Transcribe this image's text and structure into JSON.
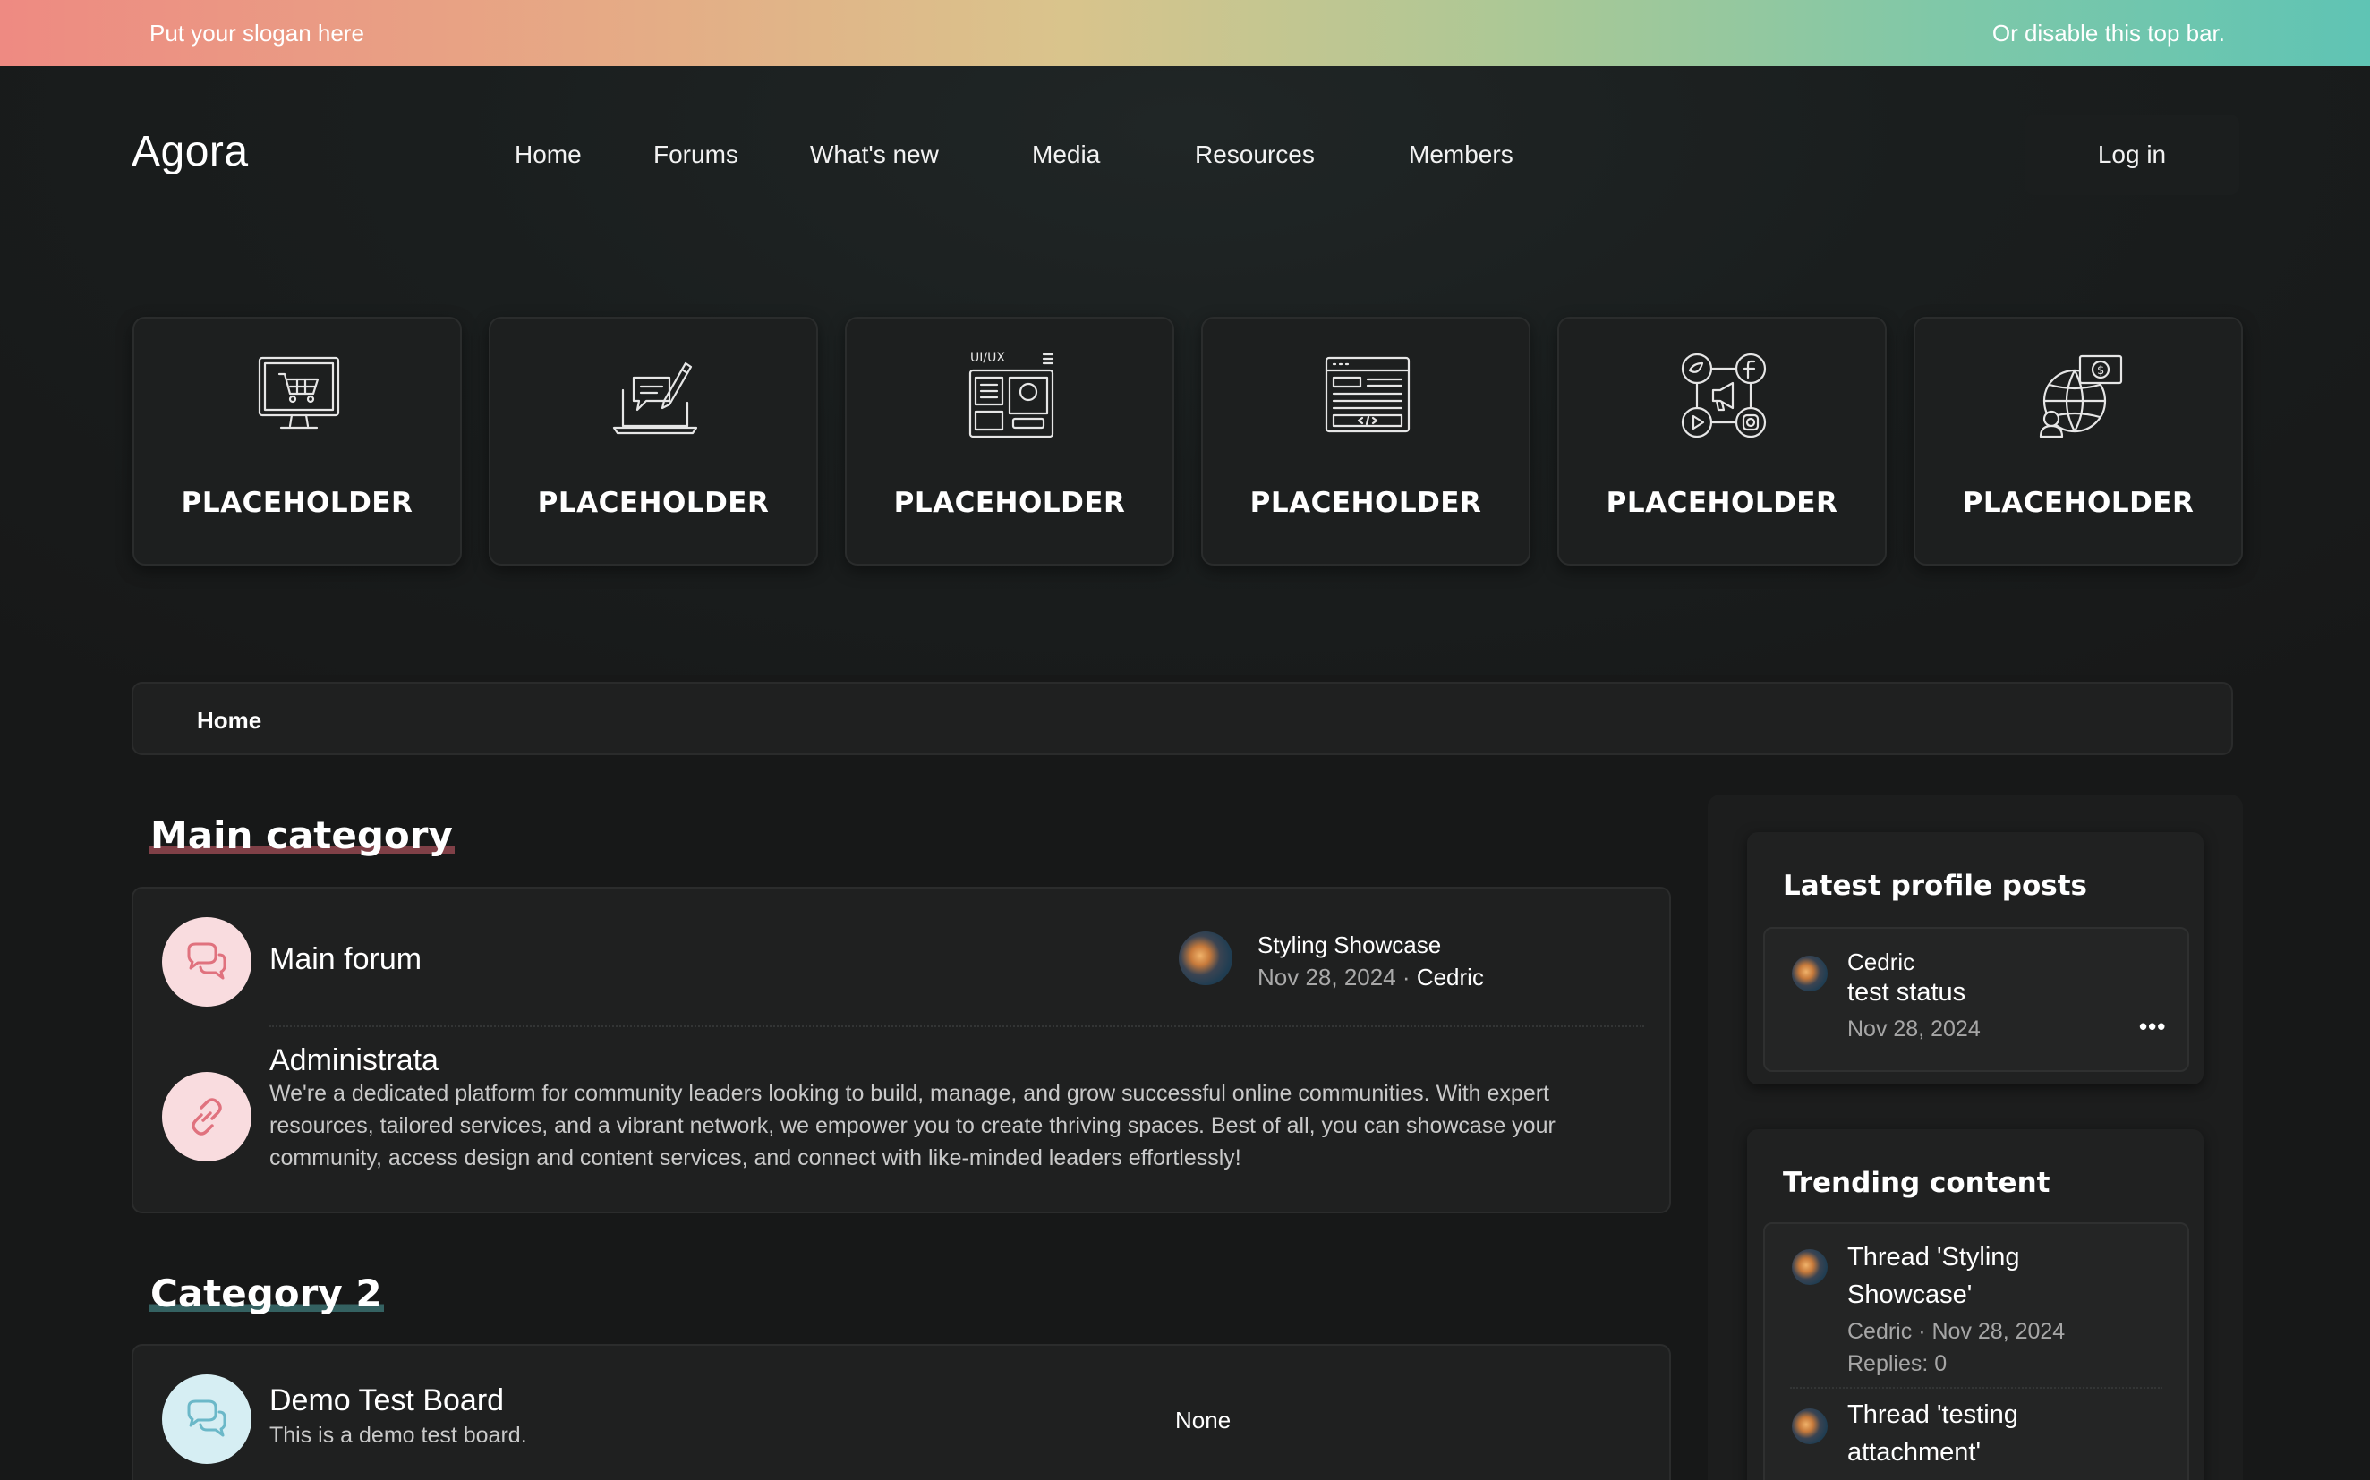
{
  "topbar": {
    "slogan": "Put your slogan here",
    "right_text": "Or disable this top bar."
  },
  "header": {
    "logo": "Agora",
    "nav": [
      {
        "label": "Home"
      },
      {
        "label": "Forums"
      },
      {
        "label": "What's new"
      },
      {
        "label": "Media"
      },
      {
        "label": "Resources"
      },
      {
        "label": "Members"
      }
    ],
    "login_label": "Log in"
  },
  "feature_cards": [
    {
      "label": "PLACEHOLDER",
      "icon": "shopping-cart-monitor-icon"
    },
    {
      "label": "PLACEHOLDER",
      "icon": "laptop-chat-pen-icon"
    },
    {
      "label": "PLACEHOLDER",
      "icon": "ui-ux-layout-icon",
      "icon_text": "UI/UX"
    },
    {
      "label": "PLACEHOLDER",
      "icon": "code-window-icon"
    },
    {
      "label": "PLACEHOLDER",
      "icon": "social-media-network-icon"
    },
    {
      "label": "PLACEHOLDER",
      "icon": "globe-money-icon"
    }
  ],
  "breadcrumb": {
    "home": "Home"
  },
  "main": {
    "categories": [
      {
        "title": "Main category",
        "nodes": [
          {
            "title": "Main forum",
            "icon": "chat-bubbles-icon",
            "latest_thread": "Styling Showcase",
            "latest_date": "Nov 28, 2024",
            "separator": "·",
            "latest_user": "Cedric"
          },
          {
            "title": "Administrata",
            "icon": "link-icon",
            "description": "We're a dedicated platform for community leaders looking to build, manage, and grow successful online communities. With expert resources, tailored services, and a vibrant network, we empower you to create thriving spaces. Best of all, you can showcase your community, access design and content services, and connect with like-minded leaders effortlessly!"
          }
        ]
      },
      {
        "title": "Category 2",
        "nodes": [
          {
            "title": "Demo Test Board",
            "icon": "chat-bubbles-icon",
            "description": "This is a demo test board.",
            "latest": "None"
          }
        ]
      }
    ]
  },
  "sidebar": {
    "profile_posts": {
      "title": "Latest profile posts",
      "items": [
        {
          "user": "Cedric",
          "text": "test status",
          "date": "Nov 28, 2024",
          "menu": "•••"
        }
      ]
    },
    "trending": {
      "title": "Trending content",
      "items": [
        {
          "title": "Thread 'Styling Showcase'",
          "user": "Cedric",
          "date": "Nov 28, 2024",
          "replies": "Replies: 0"
        },
        {
          "title": "Thread 'testing attachment'"
        }
      ]
    }
  },
  "colors": {
    "background": "#171818",
    "panel": "#1f2020",
    "accent_pink": "#f9dcdf",
    "accent_pink_icon": "#e0727e",
    "accent_blue": "#d6eef3",
    "accent_blue_icon": "#6bb8c8"
  }
}
